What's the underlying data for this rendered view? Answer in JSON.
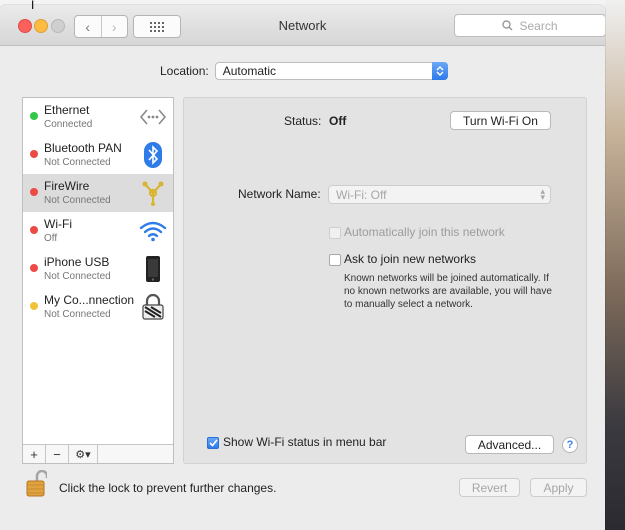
{
  "window": {
    "title": "Network"
  },
  "search": {
    "placeholder": "Search"
  },
  "location": {
    "label": "Location:",
    "value": "Automatic"
  },
  "services": [
    {
      "name": "Ethernet",
      "status": "Connected",
      "dot": "#33c748",
      "icon": "ethernet-icon"
    },
    {
      "name": "Bluetooth PAN",
      "status": "Not Connected",
      "dot": "#ec4a44",
      "icon": "bluetooth-icon"
    },
    {
      "name": "FireWire",
      "status": "Not Connected",
      "dot": "#ec4a44",
      "icon": "firewire-icon"
    },
    {
      "name": "Wi-Fi",
      "status": "Off",
      "dot": "#ec4a44",
      "icon": "wifi-icon"
    },
    {
      "name": "iPhone USB",
      "status": "Not Connected",
      "dot": "#ec4a44",
      "icon": "iphone-icon"
    },
    {
      "name": "My Co...nnection",
      "status": "Not Connected",
      "dot": "#f3c13a",
      "icon": "vpn-lock-icon"
    }
  ],
  "sidebar_toolbar": {
    "add": "+",
    "remove": "−",
    "gear": "⚙▾"
  },
  "detail": {
    "status_label": "Status:",
    "status_value": "Off",
    "turn_on_button": "Turn Wi-Fi On",
    "network_name_label": "Network Name:",
    "network_name_value": "Wi-Fi: Off",
    "auto_join_label": "Automatically join this network",
    "ask_join_label": "Ask to join new networks",
    "ask_join_help": "Known networks will be joined automatically. If no known networks are available, you will have to manually select a network.",
    "show_status_label": "Show Wi-Fi status in menu bar",
    "advanced_button": "Advanced...",
    "help_button": "?"
  },
  "footer": {
    "lock_text": "Click the lock to prevent further changes.",
    "revert_button": "Revert",
    "apply_button": "Apply"
  }
}
